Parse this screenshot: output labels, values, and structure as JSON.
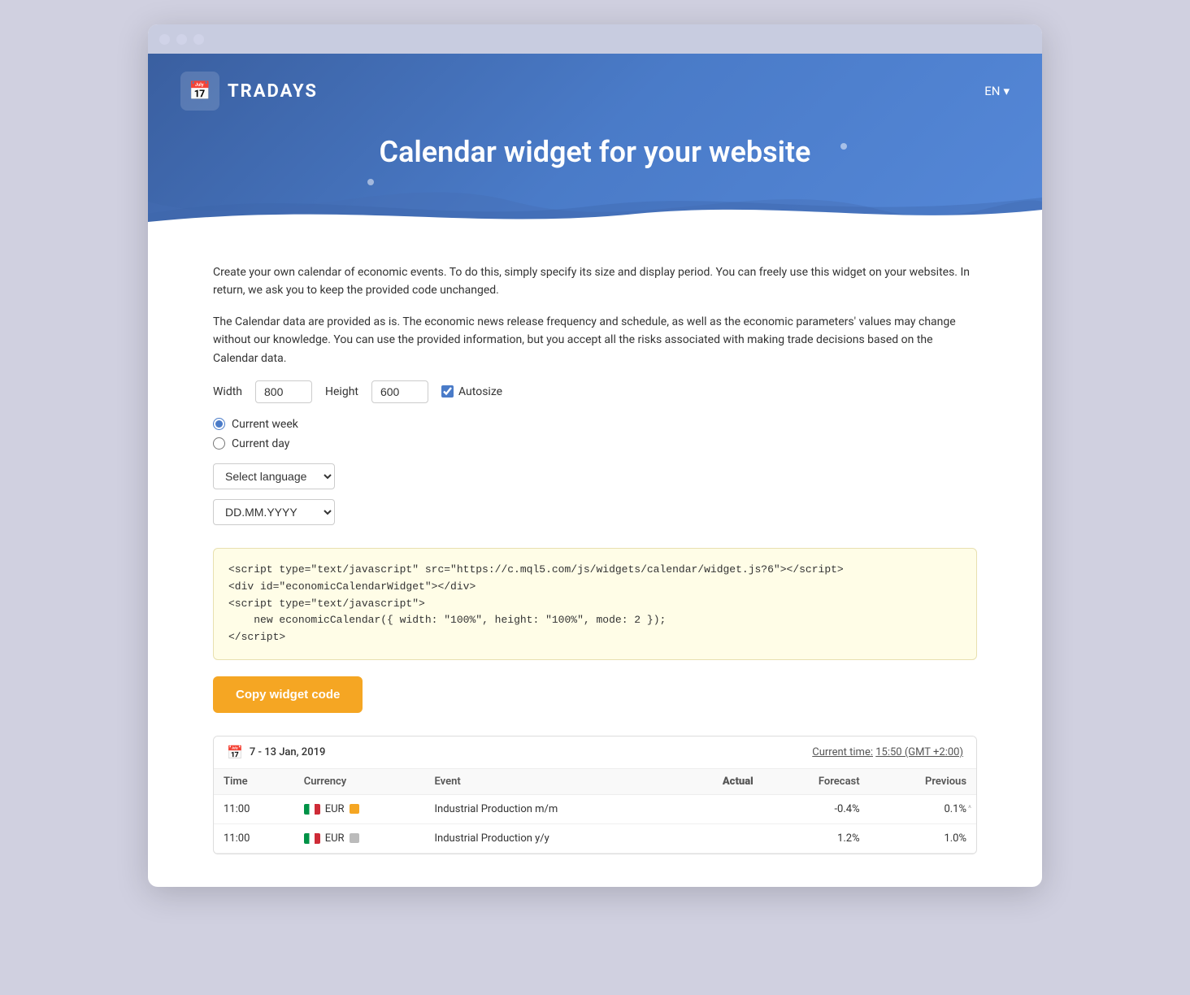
{
  "window": {
    "titlebar_dots": [
      "dot1",
      "dot2",
      "dot3"
    ]
  },
  "header": {
    "logo_icon": "📅",
    "logo_text": "TRADAYS",
    "lang": "EN",
    "lang_chevron": "▾",
    "title": "Calendar widget for your website"
  },
  "content": {
    "description1": "Create your own calendar of economic events. To do this, simply specify its size and display period. You can freely use this widget on your websites. In return, we ask you to keep the provided code unchanged.",
    "description2": "The Calendar data are provided as is. The economic news release frequency and schedule, as well as the economic parameters' values may change without our knowledge. You can use the provided information, but you accept all the risks associated with making trade decisions based on the Calendar data.",
    "width_label": "Width",
    "width_value": "800",
    "height_label": "Height",
    "height_value": "600",
    "autosize_label": "Autosize",
    "radio_current_week": "Current week",
    "radio_current_day": "Current day",
    "select_language_placeholder": "Select language",
    "date_format_value": "DD.MM.YYYY",
    "code_content": "<script type=\"text/javascript\" src=\"https://c.mql5.com/js/widgets/calendar/widget.js?6\"></script>\n<div id=\"economicCalendarWidget\"></div>\n<script type=\"text/javascript\">\n    new economicCalendar({ width: \"100%\", height: \"100%\", mode: 2 });\n</script>",
    "copy_button_label": "Copy widget code"
  },
  "widget_preview": {
    "date_range": "7 - 13 Jan, 2019",
    "current_time_label": "Current time:",
    "current_time_value": "15:50 (GMT +2:00)",
    "table": {
      "columns": [
        "Time",
        "Currency",
        "Event",
        "Actual",
        "Forecast",
        "Previous"
      ],
      "rows": [
        {
          "time": "11:00",
          "currency": "EUR",
          "flag": "it",
          "impact": "yellow",
          "event": "Industrial Production m/m",
          "actual": "",
          "forecast": "-0.4%",
          "previous": "0.1%"
        },
        {
          "time": "11:00",
          "currency": "EUR",
          "flag": "it",
          "impact": "gray",
          "event": "Industrial Production y/y",
          "actual": "",
          "forecast": "1.2%",
          "previous": "1.0%"
        }
      ]
    }
  }
}
